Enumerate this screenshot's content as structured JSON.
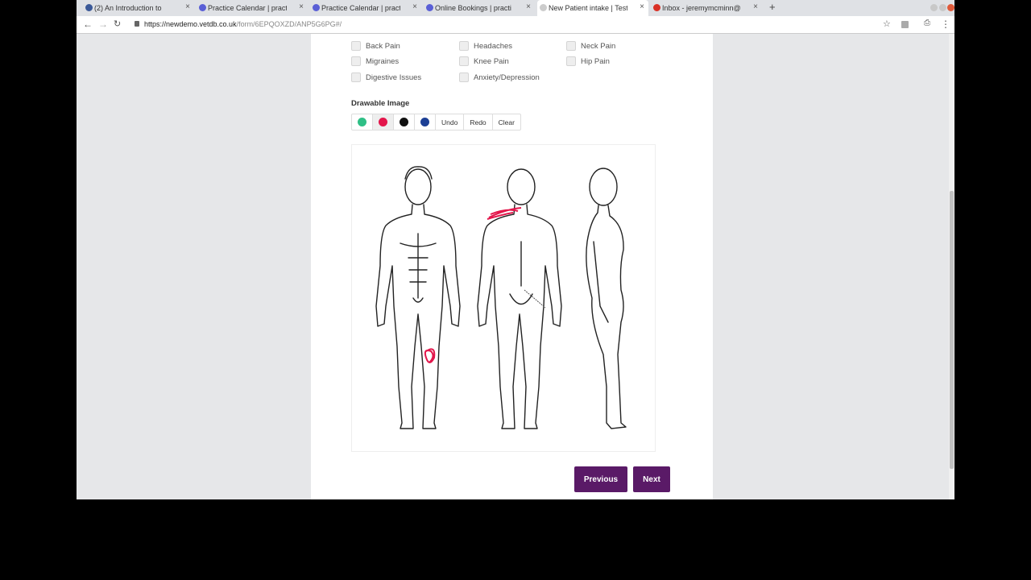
{
  "browser": {
    "tabs": [
      {
        "title": "(2) An Introduction to",
        "favicon_color": "#3b5998",
        "active": false
      },
      {
        "title": "Practice Calendar | practi",
        "favicon_color": "#5a5fd6",
        "active": false
      },
      {
        "title": "Practice Calendar | practi",
        "favicon_color": "#5a5fd6",
        "active": false
      },
      {
        "title": "Online Bookings | practi",
        "favicon_color": "#5a5fd6",
        "active": false
      },
      {
        "title": "New Patient intake | Test",
        "favicon_color": "#cccccc",
        "active": true
      },
      {
        "title": "Inbox - jeremymcminn@",
        "favicon_color": "#d93025",
        "active": false
      }
    ],
    "new_tab": "+",
    "close_glyph": "×",
    "url_host": "https://newdemo.vetdb.co.uk",
    "url_path": "/form/6EPQOXZD/ANP5G6PG#/"
  },
  "form": {
    "conditions": [
      {
        "label": "Back Pain"
      },
      {
        "label": "Headaches"
      },
      {
        "label": "Neck Pain"
      },
      {
        "label": "Migraines"
      },
      {
        "label": "Knee Pain"
      },
      {
        "label": "Hip Pain"
      },
      {
        "label": "Digestive Issues"
      },
      {
        "label": "Anxiety/Depression"
      }
    ],
    "drawable_label": "Drawable Image",
    "colors": [
      "#2fbf86",
      "#e3164b",
      "#111111",
      "#1c3f95"
    ],
    "selected_color_index": 1,
    "tools": {
      "undo": "Undo",
      "redo": "Redo",
      "clear": "Clear"
    },
    "previous_label": "Previous",
    "next_label": "Next"
  }
}
